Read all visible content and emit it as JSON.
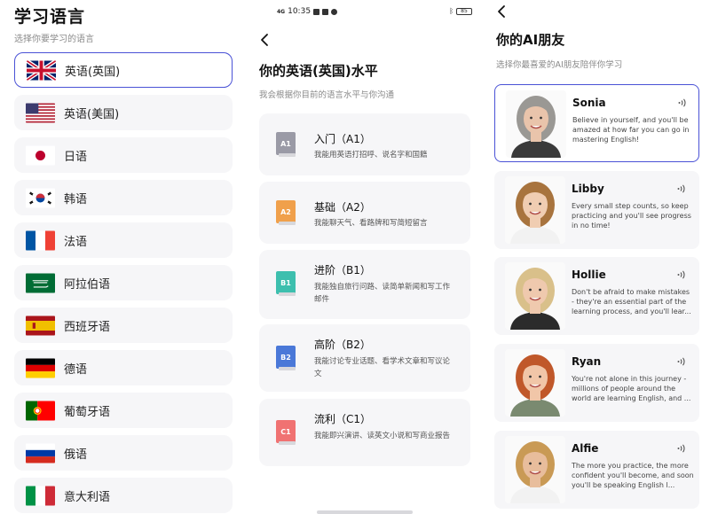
{
  "language_screen": {
    "title": "学习语言",
    "subtitle": "选择你要学习的语言",
    "languages": [
      {
        "label": "英语(英国)",
        "flag": "uk-flag-icon",
        "selected": true
      },
      {
        "label": "英语(美国)",
        "flag": "us-flag-icon",
        "selected": false
      },
      {
        "label": "日语",
        "flag": "japan-flag-icon",
        "selected": false
      },
      {
        "label": "韩语",
        "flag": "korea-flag-icon",
        "selected": false
      },
      {
        "label": "法语",
        "flag": "france-flag-icon",
        "selected": false
      },
      {
        "label": "阿拉伯语",
        "flag": "saudi-flag-icon",
        "selected": false
      },
      {
        "label": "西班牙语",
        "flag": "spain-flag-icon",
        "selected": false
      },
      {
        "label": "德语",
        "flag": "germany-flag-icon",
        "selected": false
      },
      {
        "label": "葡萄牙语",
        "flag": "portugal-flag-icon",
        "selected": false
      },
      {
        "label": "俄语",
        "flag": "russia-flag-icon",
        "selected": false
      },
      {
        "label": "意大利语",
        "flag": "italy-flag-icon",
        "selected": false
      }
    ]
  },
  "level_screen": {
    "status_bar": {
      "network": "4G",
      "time": "10:35",
      "battery": "85"
    },
    "title": "你的英语(英国)水平",
    "subtitle": "我会根据你目前的语言水平与你沟通",
    "levels": [
      {
        "badge": "A1",
        "title": "入门（A1）",
        "desc": "我能用英语打招呼、说名字和国籍",
        "color": "#9a9aa6"
      },
      {
        "badge": "A2",
        "title": "基础（A2）",
        "desc": "我能聊天气、看路牌和写简短留言",
        "color": "#f0a04b"
      },
      {
        "badge": "B1",
        "title": "进阶（B1）",
        "desc": "我能独自旅行问路、读简单新闻和写工作邮件",
        "color": "#3dbfae"
      },
      {
        "badge": "B2",
        "title": "高阶（B2）",
        "desc": "我能讨论专业话题、看学术文章和写议论文",
        "color": "#4a78d8"
      },
      {
        "badge": "C1",
        "title": "流利（C1）",
        "desc": "我能即兴演讲、读英文小说和写商业报告",
        "color": "#f07272"
      }
    ]
  },
  "friend_screen": {
    "title": "你的AI朋友",
    "subtitle": "选择你最喜爱的AI朋友陪伴你学习",
    "friends": [
      {
        "name": "Sonia",
        "quote": "Believe in yourself, and you'll be amazed at how far you can go in mastering English!",
        "selected": true,
        "hair": "#9a9894",
        "skin": "#e9c4ab",
        "shirt": "#3a3a3a"
      },
      {
        "name": "Libby",
        "quote": "Every small step counts, so keep practicing and you'll see progress in no time!",
        "selected": false,
        "hair": "#a8743e",
        "skin": "#f0cdb2",
        "shirt": "#f2f2f2"
      },
      {
        "name": "Hollie",
        "quote": "Don't be afraid to make mistakes - they're an essential part of the learning process, and you'll lear...",
        "selected": false,
        "hair": "#d9c08a",
        "skin": "#efc9ae",
        "shirt": "#2b2b2b"
      },
      {
        "name": "Ryan",
        "quote": "You're not alone in this journey - millions of people around the world are learning English, and ...",
        "selected": false,
        "hair": "#c0582a",
        "skin": "#f1c6a8",
        "shirt": "#7a8a70"
      },
      {
        "name": "Alfie",
        "quote": "The more you practice, the more confident you'll become, and soon you'll be speaking English l...",
        "selected": false,
        "hair": "#c99a55",
        "skin": "#e8bd9c",
        "shirt": "#f2f2f2"
      }
    ]
  }
}
